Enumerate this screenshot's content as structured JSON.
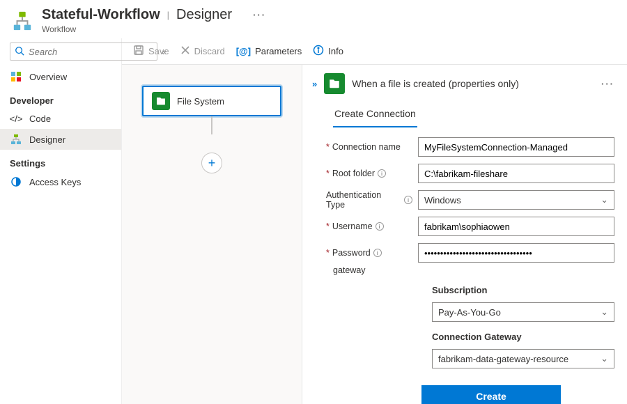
{
  "header": {
    "title": "Stateful-Workflow",
    "section": "Designer",
    "subtitle": "Workflow"
  },
  "search": {
    "placeholder": "Search"
  },
  "nav": {
    "overview": "Overview",
    "dev_label": "Developer",
    "code": "Code",
    "designer": "Designer",
    "settings_label": "Settings",
    "access_keys": "Access Keys"
  },
  "toolbar": {
    "save": "Save",
    "discard": "Discard",
    "parameters": "Parameters",
    "info": "Info"
  },
  "canvas": {
    "node_label": "File System"
  },
  "panel": {
    "title": "When a file is created (properties only)",
    "tab": "Create Connection",
    "labels": {
      "connection_name": "Connection name",
      "root_folder": "Root folder",
      "auth_type": "Authentication Type",
      "username": "Username",
      "password": "Password",
      "gateway": "gateway",
      "subscription": "Subscription",
      "connection_gateway": "Connection Gateway"
    },
    "values": {
      "connection_name": "MyFileSystemConnection-Managed",
      "root_folder": "C:\\fabrikam-fileshare",
      "auth_type": "Windows",
      "username": "fabrikam\\sophiaowen",
      "password": "••••••••••••••••••••••••••••••••••",
      "subscription": "Pay-As-You-Go",
      "connection_gateway": "fabrikam-data-gateway-resource"
    },
    "create_button": "Create"
  }
}
